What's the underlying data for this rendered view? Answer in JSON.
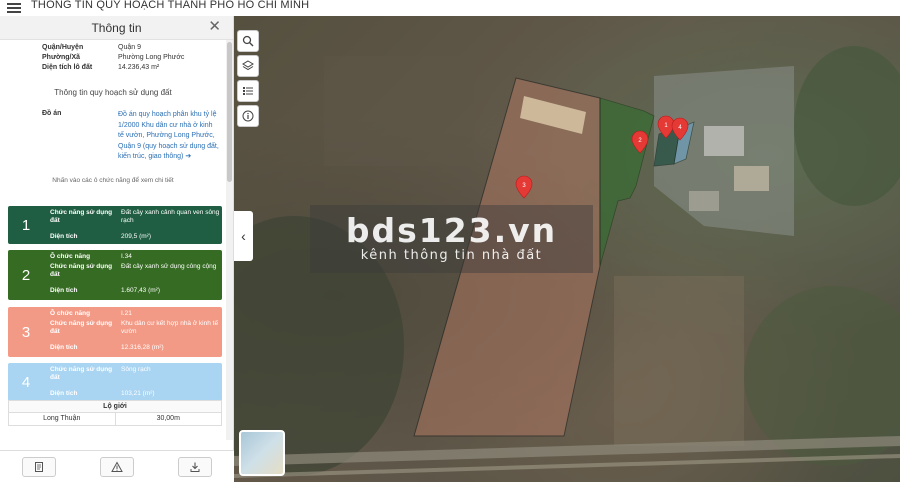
{
  "app": {
    "title": "THÔNG TIN QUY HOẠCH THÀNH PHỐ HỒ CHÍ MINH"
  },
  "panel": {
    "title": "Thông tin",
    "info": [
      {
        "label": "Quận/Huyện",
        "value": "Quận 9"
      },
      {
        "label": "Phường/Xã",
        "value": "Phường Long Phước"
      },
      {
        "label": "Diện tích lô đất",
        "value": "14.236,43 m²"
      }
    ],
    "section_title": "Thông tin quy hoạch sử dụng đất",
    "doan": {
      "label": "Đồ án",
      "value": "Đồ án quy hoạch phân khu tỷ lệ 1/2000 Khu dân cư nhà ở kinh tế vườn, Phường Long Phước, Quận 9 (quy hoạch sử dụng đất, kiến trúc, giao thông)"
    },
    "hint": "Nhấn vào các ô chức năng để xem chi tiết",
    "zones": [
      {
        "num": "1",
        "color": "#1f5e42",
        "rows": [
          {
            "label": "Chức năng sử dụng đất",
            "value": "Đất cây xanh cảnh quan ven sông rạch"
          },
          {
            "label": "Diện tích",
            "value": "209,5 (m²)"
          }
        ]
      },
      {
        "num": "2",
        "color": "#356b22",
        "rows": [
          {
            "label": "Ô chức năng",
            "value": "I.34"
          },
          {
            "label": "Chức năng sử dụng đất",
            "value": "Đất cây xanh sử dụng công cộng"
          },
          {
            "label": "Diện tích",
            "value": "1.607,43 (m²)"
          }
        ]
      },
      {
        "num": "3",
        "color": "#f39a86",
        "rows": [
          {
            "label": "Ô chức năng",
            "value": "I.21"
          },
          {
            "label": "Chức năng sử dụng đất",
            "value": "Khu dân cư kết hợp nhà ở kinh tế vườn"
          },
          {
            "label": "Diện tích",
            "value": "12.316,28 (m²)"
          }
        ]
      },
      {
        "num": "4",
        "color": "#a9d4f2",
        "rows": [
          {
            "label": "Chức năng sử dụng đất",
            "value": "Sông rạch"
          },
          {
            "label": "Diện tích",
            "value": "103,21 (m²)"
          }
        ]
      }
    ],
    "lo_gioi": {
      "header": "Lộ giới",
      "rows": [
        {
          "name": "Long Thuận",
          "value": "30,00m"
        }
      ]
    },
    "footer_icons": [
      "document-icon",
      "warning-icon",
      "download-icon"
    ]
  },
  "map": {
    "tools": [
      "search-icon",
      "layers-icon",
      "list-icon",
      "info-icon"
    ],
    "markers": [
      "1",
      "2",
      "3",
      "4"
    ],
    "watermark": {
      "main": "bds123.vn",
      "sub": "kênh thông tin nhà đất"
    }
  }
}
